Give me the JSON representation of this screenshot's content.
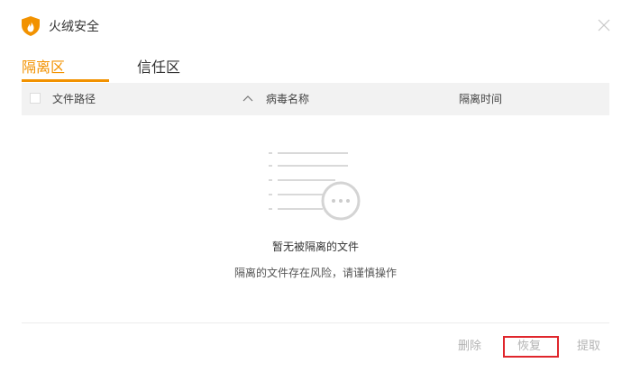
{
  "app": {
    "title": "火绒安全",
    "brand_color": "#f29200",
    "logo_icon": "huorong-shield-flame-icon",
    "close_icon": "close-icon"
  },
  "tabs": [
    {
      "label": "隔离区",
      "active": true
    },
    {
      "label": "信任区",
      "active": false
    }
  ],
  "table": {
    "select_all_checked": false,
    "columns": {
      "path": "文件路径",
      "virus_name": "病毒名称",
      "time": "隔离时间"
    },
    "sort_icon": "chevron-up-icon",
    "rows": []
  },
  "empty_state": {
    "icon": "empty-list-icon",
    "title": "暂无被隔离的文件",
    "subtitle": "隔离的文件存在风险，请谨慎操作"
  },
  "footer": {
    "delete_label": "删除",
    "restore_label": "恢复",
    "extract_label": "提取",
    "highlight_color": "#e0262c"
  }
}
